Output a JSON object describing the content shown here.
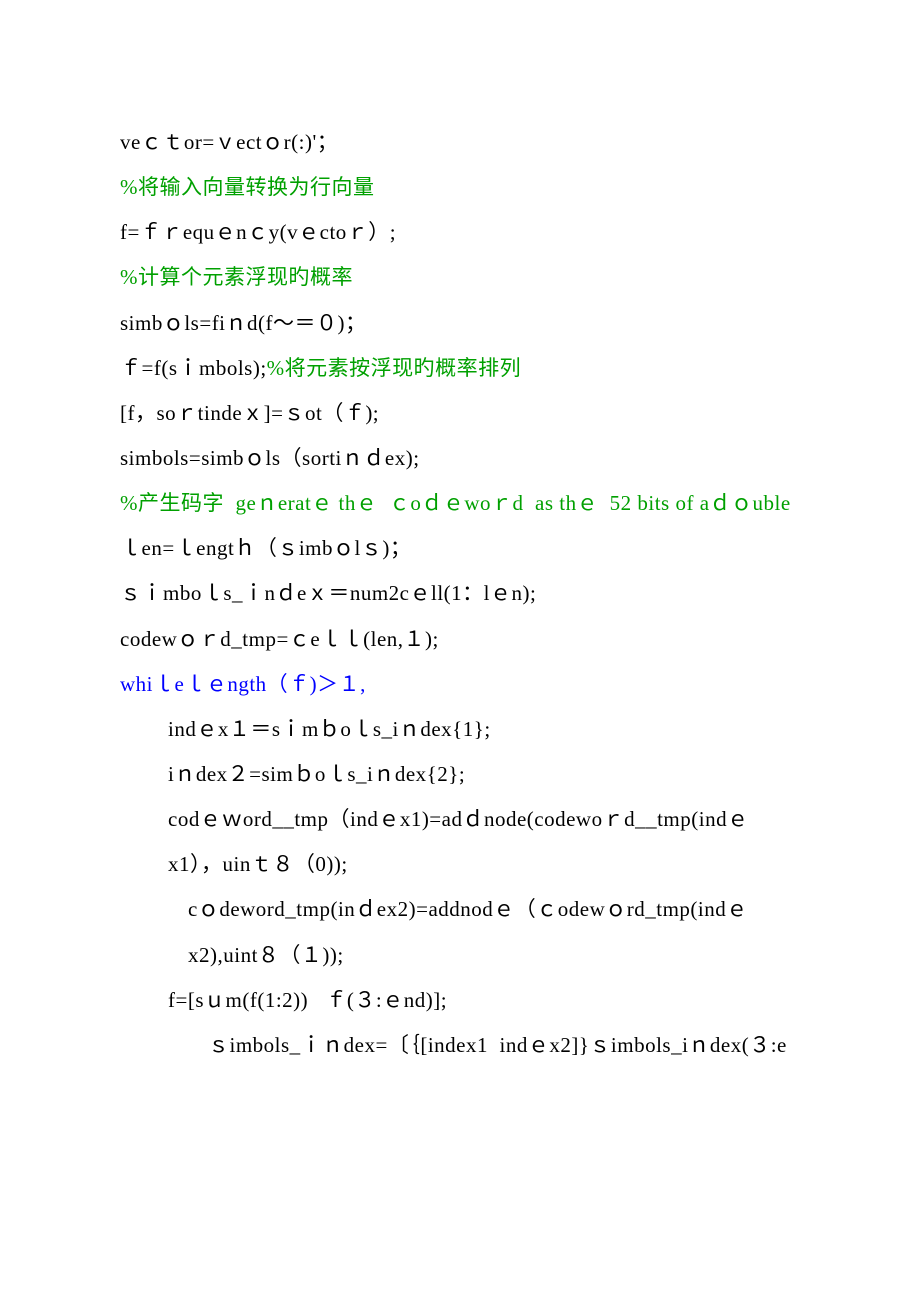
{
  "lines": [
    {
      "cls": "",
      "segs": [
        {
          "t": "veｃｔor=ｖectｏr(:)'；",
          "c": ""
        }
      ]
    },
    {
      "cls": "",
      "segs": [
        {
          "t": "%将输入向量转换为行向量",
          "c": "green"
        }
      ]
    },
    {
      "cls": "",
      "segs": [
        {
          "t": "f=ｆｒequｅnｃy(vｅctoｒ）;",
          "c": ""
        }
      ]
    },
    {
      "cls": "",
      "segs": [
        {
          "t": "%计算个元素浮现旳概率",
          "c": "green"
        }
      ]
    },
    {
      "cls": "",
      "segs": [
        {
          "t": "simbｏls=fiｎd(f～＝０)；",
          "c": ""
        }
      ]
    },
    {
      "cls": "",
      "segs": [
        {
          "t": "ｆ=f(sｉmbols);",
          "c": ""
        },
        {
          "t": "%将元素按浮现旳概率排列",
          "c": "green"
        }
      ]
    },
    {
      "cls": "",
      "segs": [
        {
          "t": "[f，soｒtindeｘ]=ｓot（ｆ);",
          "c": ""
        }
      ]
    },
    {
      "cls": "",
      "segs": [
        {
          "t": "simbols=simbｏls（sortiｎｄex);",
          "c": ""
        }
      ]
    },
    {
      "cls": "",
      "segs": [
        {
          "t": "%产生码字  geｎeratｅ thｅ  ｃoｄｅwoｒd  as thｅ  52 bits of aｄｏuble",
          "c": "green"
        }
      ]
    },
    {
      "cls": "",
      "segs": [
        {
          "t": "ｌen=ｌengtｈ（ｓimbｏlｓ)；",
          "c": ""
        }
      ]
    },
    {
      "cls": "",
      "segs": [
        {
          "t": "ｓｉmboｌs_ｉnｄeｘ＝num2cｅll(1：lｅn);",
          "c": ""
        }
      ]
    },
    {
      "cls": "",
      "segs": [
        {
          "t": "codewｏｒd_tmp=ｃeｌｌ(len,１);",
          "c": ""
        }
      ]
    },
    {
      "cls": "",
      "segs": [
        {
          "t": "whiｌeｌｅngth（ｆ)＞１,",
          "c": "blue"
        }
      ]
    },
    {
      "cls": "indent1",
      "segs": [
        {
          "t": "indｅx１＝sｉmｂoｌs_iｎdex{1};",
          "c": ""
        }
      ]
    },
    {
      "cls": "indent1",
      "segs": [
        {
          "t": "iｎdex２=simｂoｌs_iｎdex{2};",
          "c": ""
        }
      ]
    },
    {
      "cls": "indent1",
      "segs": [
        {
          "t": "codｅｗord__tmp（indｅx1)=adｄnode(codewoｒd__tmp(indｅx1），uinｔ８（0));",
          "c": ""
        }
      ]
    },
    {
      "cls": "indent2",
      "segs": [
        {
          "t": "cｏdeword_tmp(inｄex2)=addnodｅ（ｃodewｏrd_tmp(indｅx2),uint８（１));",
          "c": ""
        }
      ]
    },
    {
      "cls": "indent1",
      "segs": [
        {
          "t": "f=[sｕm(f(1:2))   ｆ(３:ｅnd)];",
          "c": ""
        }
      ]
    },
    {
      "cls": "indent3",
      "segs": [
        {
          "t": "ｓimbols_ｉｎdex=〔｛[index1  indｅx2]}ｓimbols_iｎdex(３:e",
          "c": ""
        }
      ]
    }
  ]
}
